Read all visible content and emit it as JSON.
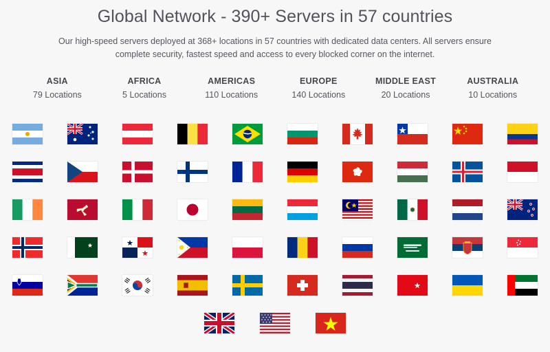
{
  "header": {
    "title": "Global Network - 390+ Servers in 57 countries",
    "subtitle": "Our high-speed servers deployed at 368+ locations in 57 countries with dedicated data centers. All servers ensure complete security, fastest speed and access to every blocked corner on the internet."
  },
  "regions": [
    {
      "name": "ASIA",
      "count": "79 Locations"
    },
    {
      "name": "AFRICA",
      "count": "5 Locations"
    },
    {
      "name": "AMERICAS",
      "count": "110 Locations"
    },
    {
      "name": "EUROPE",
      "count": "140 Locations"
    },
    {
      "name": "MIDDLE EAST",
      "count": "20 Locations"
    },
    {
      "name": "AUSTRALIA",
      "count": "10 Locations"
    }
  ],
  "colors": {
    "background": "#f7f7f7",
    "title_text": "#52525c",
    "body_text": "#555560",
    "heading_text": "#45454e"
  },
  "flag_grid": {
    "columns": 10,
    "rows": [
      [
        "Argentina",
        "Australia",
        "Austria",
        "Belgium",
        "Brazil",
        "Bulgaria",
        "Canada",
        "Chile",
        "China",
        "Colombia"
      ],
      [
        "Costa Rica",
        "Czech Republic",
        "Denmark",
        "Finland",
        "France",
        "Germany",
        "Hong Kong",
        "Hungary",
        "Iceland",
        "Indonesia"
      ],
      [
        "Ireland",
        "Isle of Man",
        "Italy",
        "Japan",
        "Lithuania",
        "Luxembourg",
        "Malaysia",
        "Mexico",
        "Netherlands",
        "New Zealand"
      ],
      [
        "Norway",
        "Pakistan",
        "Panama",
        "Philippines",
        "Poland",
        "Romania",
        "Russia",
        "Saudi Arabia",
        "Serbia",
        "Singapore"
      ],
      [
        "Slovenia",
        "South Africa",
        "South Korea",
        "Spain",
        "Sweden",
        "Switzerland",
        "Thailand",
        "Turkey",
        "Ukraine",
        "United Arab Emirates"
      ],
      [
        "United Kingdom",
        "United States",
        "Vietnam"
      ]
    ]
  }
}
